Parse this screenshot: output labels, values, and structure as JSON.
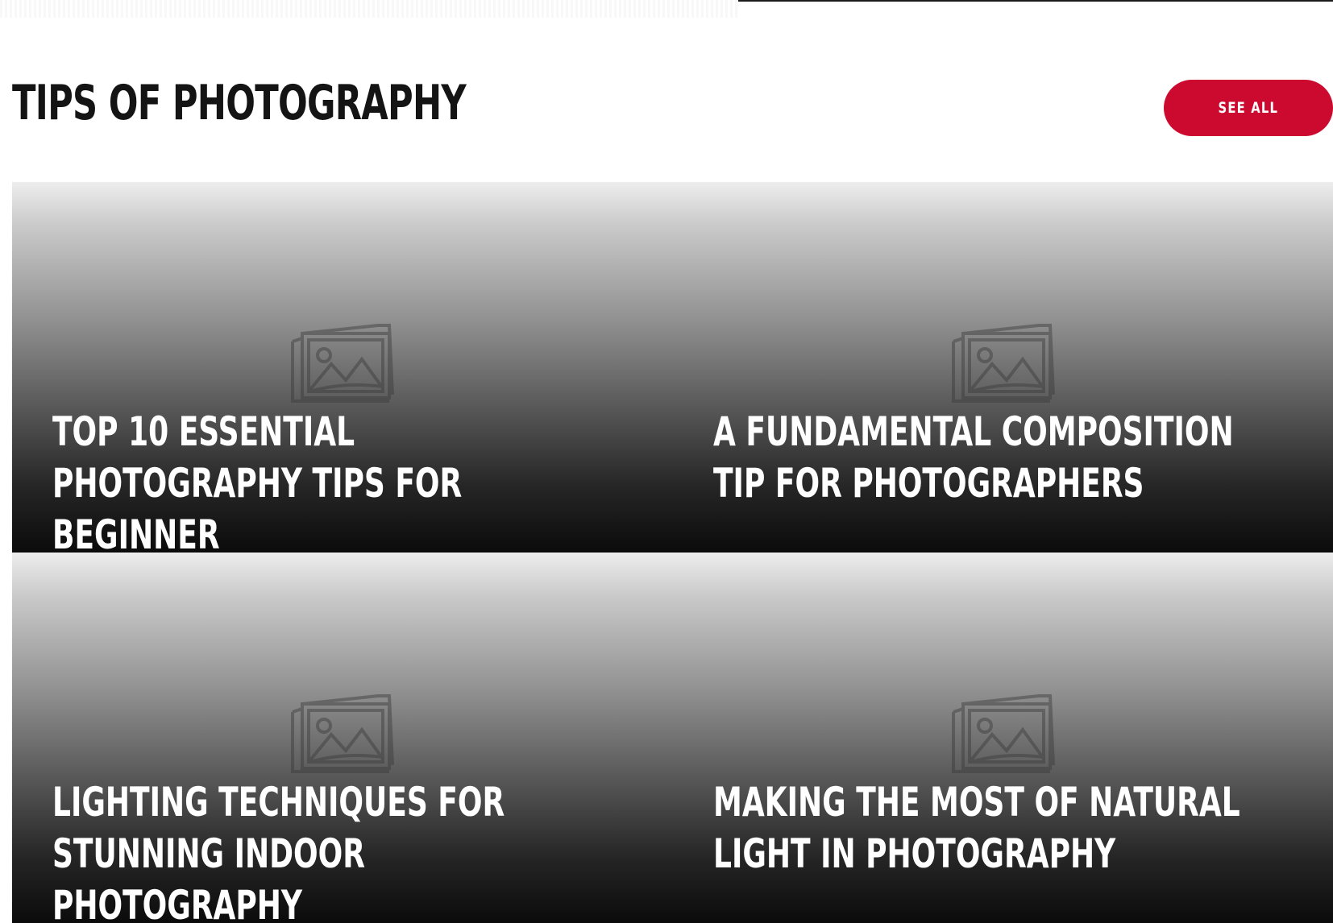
{
  "section": {
    "title": "TIPS OF PHOTOGRAPHY",
    "see_all_label": "SEE ALL"
  },
  "colors": {
    "accent": "#cc0a2f",
    "title_text": "#141414",
    "card_text": "#ffffff"
  },
  "cards": [
    {
      "title": "TOP 10 ESSENTIAL PHOTOGRAPHY TIPS FOR BEGINNER",
      "icon": "image-placeholder-icon"
    },
    {
      "title": "A FUNDAMENTAL COMPOSITION TIP FOR PHOTOGRAPHERS",
      "icon": "image-placeholder-icon"
    },
    {
      "title": "LIGHTING TECHNIQUES FOR STUNNING INDOOR PHOTOGRAPHY",
      "icon": "image-placeholder-icon"
    },
    {
      "title": "MAKING THE MOST OF NATURAL LIGHT IN PHOTOGRAPHY",
      "icon": "image-placeholder-icon"
    }
  ]
}
